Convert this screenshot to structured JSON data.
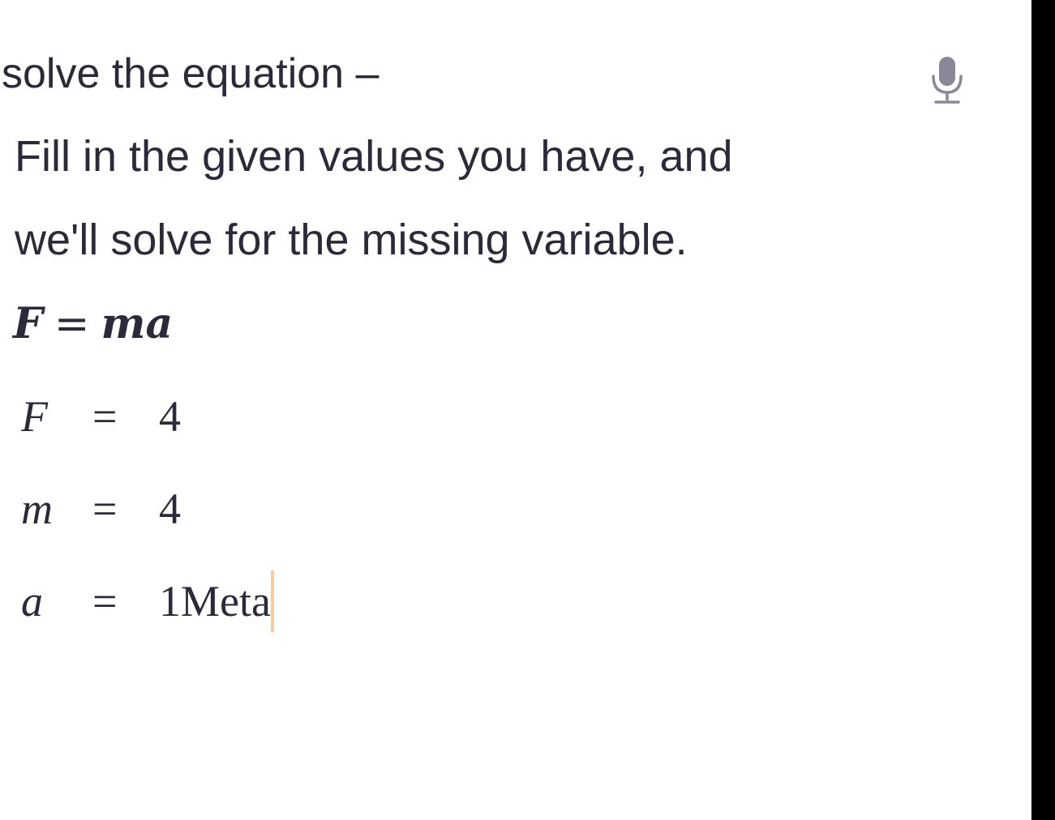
{
  "search": {
    "query": "solve the equation –",
    "mic_icon": "microphone-icon"
  },
  "intro": {
    "line1": "Fill in the given values you have, and",
    "line2": "we'll solve for the missing variable."
  },
  "formula": {
    "lhs": "F",
    "eq": "=",
    "rhs": "ma"
  },
  "variables": [
    {
      "name": "F",
      "eq": "=",
      "value": "4"
    },
    {
      "name": "m",
      "eq": "=",
      "value": "4"
    },
    {
      "name": "a",
      "eq": "=",
      "value": "1Meta"
    }
  ],
  "colors": {
    "text": "#2b2a3a",
    "caret": "#f7c9a4",
    "icon": "#8a8897"
  }
}
